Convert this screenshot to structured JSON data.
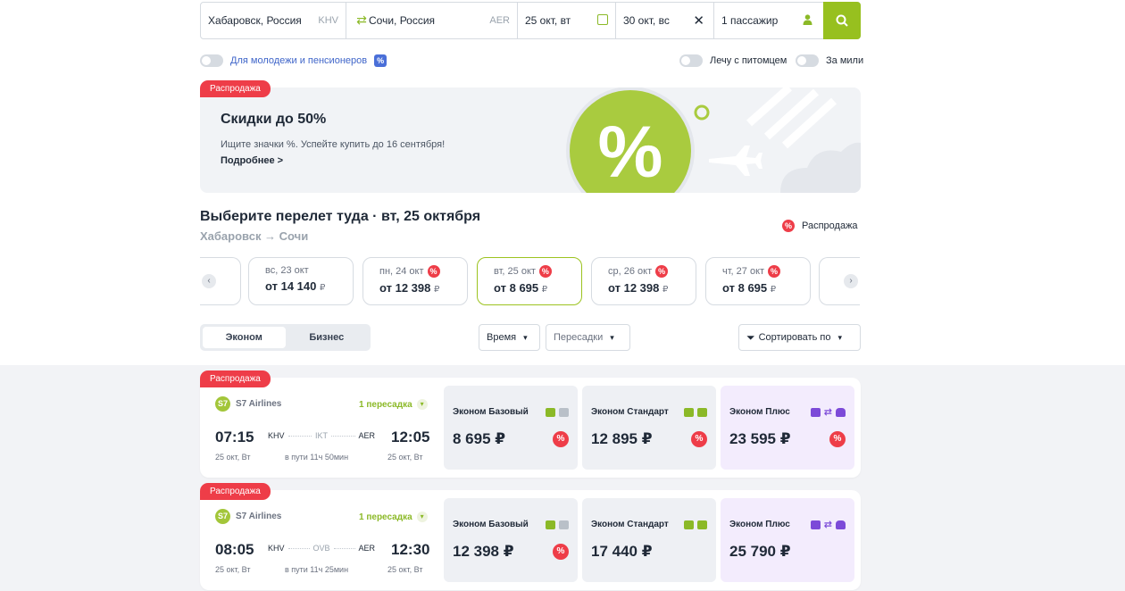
{
  "search": {
    "from_city": "Хабаровск, Россия",
    "from_code": "KHV",
    "to_city": "Сочи, Россия",
    "to_code": "AER",
    "date_there": "25 окт, вт",
    "date_back": "30 окт, вс",
    "passengers": "1 пассажир"
  },
  "options": {
    "youth": "Для молодежи и пенсионеров",
    "pet": "Лечу с питомцем",
    "miles": "За мили"
  },
  "banner": {
    "tag": "Распродажа",
    "title": "Скидки до 50%",
    "text": "Ищите значки %. Успейте купить до 16 сентября!",
    "link": "Подробнее >"
  },
  "section": {
    "title": "Выберите перелет туда · вт, 25 октября",
    "route": "Хабаровск → Сочи",
    "legend": "Распродажа"
  },
  "dates": [
    {
      "day": "вс, 23 окт",
      "price": "от 14 140",
      "sale": false
    },
    {
      "day": "пн, 24 окт",
      "price": "от 12 398",
      "sale": true
    },
    {
      "day": "вт, 25 окт",
      "price": "от 8 695",
      "sale": true
    },
    {
      "day": "ср, 26 окт",
      "price": "от 12 398",
      "sale": true
    },
    {
      "day": "чт, 27 окт",
      "price": "от 8 695",
      "sale": true
    }
  ],
  "currency_small": "₽",
  "filters": {
    "economy": "Эконом",
    "business": "Бизнес",
    "time": "Время",
    "transfers": "Пересадки",
    "sort": "Сортировать по"
  },
  "flights": [
    {
      "tag": "Распродажа",
      "airline": "S7 Airlines",
      "stops": "1 пересадка",
      "dep_time": "07:15",
      "arr_time": "12:05",
      "dep_code": "KHV",
      "via_code": "IKT",
      "arr_code": "AER",
      "dep_date": "25 окт, Вт",
      "arr_date": "25 окт, Вт",
      "duration": "в пути 11ч 50мин",
      "fares": [
        {
          "name": "Эконом Базовый",
          "price": "8 695 ₽",
          "sale": true
        },
        {
          "name": "Эконом Стандарт",
          "price": "12 895 ₽",
          "sale": true
        },
        {
          "name": "Эконом Плюс",
          "price": "23 595 ₽",
          "sale": true
        }
      ]
    },
    {
      "tag": "Распродажа",
      "airline": "S7 Airlines",
      "stops": "1 пересадка",
      "dep_time": "08:05",
      "arr_time": "12:30",
      "dep_code": "KHV",
      "via_code": "OVB",
      "arr_code": "AER",
      "dep_date": "25 окт, Вт",
      "arr_date": "25 окт, Вт",
      "duration": "в пути 11ч 25мин",
      "fares": [
        {
          "name": "Эконом Базовый",
          "price": "12 398 ₽",
          "sale": true
        },
        {
          "name": "Эконом Стандарт",
          "price": "17 440 ₽",
          "sale": false
        },
        {
          "name": "Эконом Плюс",
          "price": "25 790 ₽",
          "sale": false
        }
      ]
    }
  ],
  "colors": {
    "accent": "#97c01f",
    "sale": "#ee3d48",
    "plus": "#7c4ad8"
  }
}
